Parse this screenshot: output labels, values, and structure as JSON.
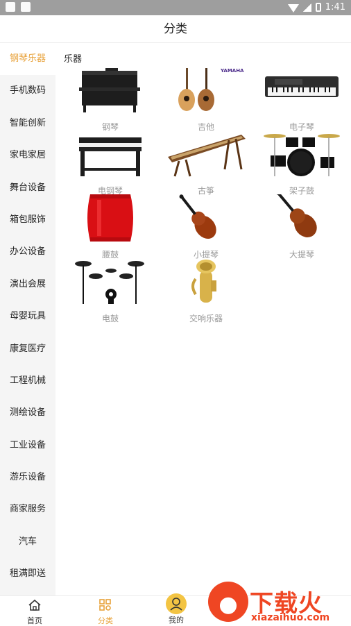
{
  "status": {
    "time": "1:41"
  },
  "header": {
    "title": "分类"
  },
  "sidebar": {
    "items": [
      {
        "label": "钢琴乐器",
        "active": true
      },
      {
        "label": "手机数码"
      },
      {
        "label": "智能创新"
      },
      {
        "label": "家电家居"
      },
      {
        "label": "舞台设备"
      },
      {
        "label": "箱包服饰"
      },
      {
        "label": "办公设备"
      },
      {
        "label": "演出会展"
      },
      {
        "label": "母婴玩具"
      },
      {
        "label": "康复医疗"
      },
      {
        "label": "工程机械"
      },
      {
        "label": "测绘设备"
      },
      {
        "label": "工业设备"
      },
      {
        "label": "游乐设备"
      },
      {
        "label": "商家服务"
      },
      {
        "label": "汽车"
      },
      {
        "label": "租满即送"
      }
    ]
  },
  "main": {
    "section_title": "乐器",
    "items": [
      {
        "label": "钢琴",
        "icon": "upright-piano"
      },
      {
        "label": "吉他",
        "icon": "guitar",
        "brand": "YAMAHA"
      },
      {
        "label": "电子琴",
        "icon": "keyboard"
      },
      {
        "label": "电钢琴",
        "icon": "digital-piano"
      },
      {
        "label": "古筝",
        "icon": "guzheng"
      },
      {
        "label": "架子鼓",
        "icon": "drum-kit"
      },
      {
        "label": "腰鼓",
        "icon": "waist-drum"
      },
      {
        "label": "小提琴",
        "icon": "violin"
      },
      {
        "label": "大提琴",
        "icon": "cello"
      },
      {
        "label": "电鼓",
        "icon": "electronic-drum"
      },
      {
        "label": "交响乐器",
        "icon": "tuba"
      }
    ]
  },
  "tabbar": {
    "tabs": [
      {
        "label": "首页",
        "icon": "home-icon"
      },
      {
        "label": "分类",
        "icon": "category-icon",
        "active": true
      },
      {
        "label": "我的",
        "icon": "user-icon"
      }
    ]
  },
  "watermark": {
    "text": "下载火",
    "url": "xiazaihuo.com"
  },
  "colors": {
    "accent": "#e8a23a",
    "watermark": "#ef4623"
  }
}
